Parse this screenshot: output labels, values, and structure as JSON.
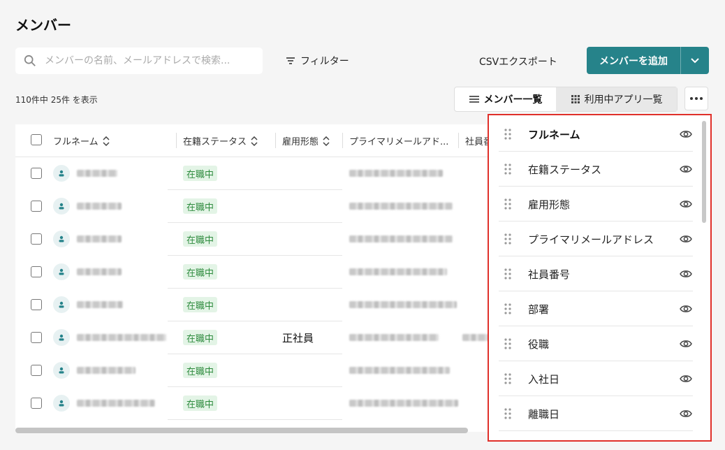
{
  "page": {
    "title": "メンバー"
  },
  "toolbar": {
    "search_placeholder": "メンバーの名前、メールアドレスで検索...",
    "filter_label": "フィルター",
    "csv_export_label": "CSVエクスポート",
    "add_member_label": "メンバーを追加"
  },
  "summary": {
    "count_text": "110件中 25件 を表示"
  },
  "view_toggle": {
    "list_label": "メンバー一覧",
    "apps_label": "利用中アプリ一覧"
  },
  "table": {
    "headers": [
      "フルネーム",
      "在籍ステータス",
      "雇用形態",
      "プライマリメールアド...",
      "社員番"
    ],
    "rows": [
      {
        "status": "在職中",
        "employment_type": ""
      },
      {
        "status": "在職中",
        "employment_type": ""
      },
      {
        "status": "在職中",
        "employment_type": ""
      },
      {
        "status": "在職中",
        "employment_type": ""
      },
      {
        "status": "在職中",
        "employment_type": ""
      },
      {
        "status": "在職中",
        "employment_type": "正社員"
      },
      {
        "status": "在職中",
        "employment_type": ""
      },
      {
        "status": "在職中",
        "employment_type": ""
      }
    ]
  },
  "column_panel": {
    "items": [
      {
        "label": "フルネーム"
      },
      {
        "label": "在籍ステータス"
      },
      {
        "label": "雇用形態"
      },
      {
        "label": "プライマリメールアドレス"
      },
      {
        "label": "社員番号"
      },
      {
        "label": "部署"
      },
      {
        "label": "役職"
      },
      {
        "label": "入社日"
      },
      {
        "label": "離職日"
      }
    ]
  },
  "colors": {
    "accent": "#26838a",
    "status_bg": "#e3f4e6",
    "status_text": "#2e8b3e",
    "highlight_border": "#e0302a"
  },
  "icons": [
    "search-icon",
    "filter-icon",
    "chevron-down-icon",
    "list-icon",
    "grid-icon",
    "more-icon",
    "sort-icon",
    "person-icon",
    "drag-handle-icon",
    "eye-icon"
  ]
}
